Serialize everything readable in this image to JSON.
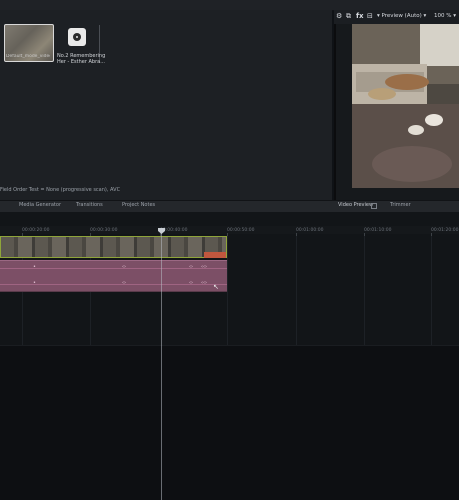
{
  "media_browser": {
    "items": [
      {
        "caption": "Default_mode_video"
      },
      {
        "name_line1": "No.2 Remembering",
        "name_line2": "Her - Esther Abra..."
      }
    ],
    "status_text": "Field Order Test = None (progressive scan), AVC"
  },
  "viewer": {
    "preview_label": "Preview (Auto)",
    "zoom": "100 %"
  },
  "tabs": {
    "media_generator": "Media Generator",
    "transitions": "Transitions",
    "project_notes": "Project Notes",
    "video_preview": "Video Preview",
    "trimmer": "Trimmer"
  },
  "timeline": {
    "ruler_ticks": [
      "00:00:20:00",
      "00:00:30:00",
      "00:00:40:00",
      "00:00:50:00",
      "00:01:00:00",
      "00:01:10:00",
      "00:01:20:00"
    ]
  },
  "colors": {
    "video_clip_border": "#8fa53a",
    "audio_clip": "#7c4f66",
    "clip_marker": "#c0573e"
  }
}
